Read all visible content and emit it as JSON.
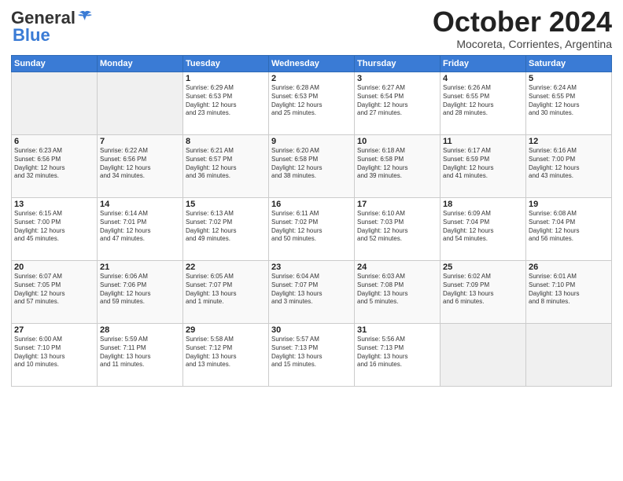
{
  "header": {
    "logo_general": "General",
    "logo_blue": "Blue",
    "month": "October 2024",
    "location": "Mocoreta, Corrientes, Argentina"
  },
  "weekdays": [
    "Sunday",
    "Monday",
    "Tuesday",
    "Wednesday",
    "Thursday",
    "Friday",
    "Saturday"
  ],
  "weeks": [
    [
      {
        "day": "",
        "info": ""
      },
      {
        "day": "",
        "info": ""
      },
      {
        "day": "1",
        "info": "Sunrise: 6:29 AM\nSunset: 6:53 PM\nDaylight: 12 hours\nand 23 minutes."
      },
      {
        "day": "2",
        "info": "Sunrise: 6:28 AM\nSunset: 6:53 PM\nDaylight: 12 hours\nand 25 minutes."
      },
      {
        "day": "3",
        "info": "Sunrise: 6:27 AM\nSunset: 6:54 PM\nDaylight: 12 hours\nand 27 minutes."
      },
      {
        "day": "4",
        "info": "Sunrise: 6:26 AM\nSunset: 6:55 PM\nDaylight: 12 hours\nand 28 minutes."
      },
      {
        "day": "5",
        "info": "Sunrise: 6:24 AM\nSunset: 6:55 PM\nDaylight: 12 hours\nand 30 minutes."
      }
    ],
    [
      {
        "day": "6",
        "info": "Sunrise: 6:23 AM\nSunset: 6:56 PM\nDaylight: 12 hours\nand 32 minutes."
      },
      {
        "day": "7",
        "info": "Sunrise: 6:22 AM\nSunset: 6:56 PM\nDaylight: 12 hours\nand 34 minutes."
      },
      {
        "day": "8",
        "info": "Sunrise: 6:21 AM\nSunset: 6:57 PM\nDaylight: 12 hours\nand 36 minutes."
      },
      {
        "day": "9",
        "info": "Sunrise: 6:20 AM\nSunset: 6:58 PM\nDaylight: 12 hours\nand 38 minutes."
      },
      {
        "day": "10",
        "info": "Sunrise: 6:18 AM\nSunset: 6:58 PM\nDaylight: 12 hours\nand 39 minutes."
      },
      {
        "day": "11",
        "info": "Sunrise: 6:17 AM\nSunset: 6:59 PM\nDaylight: 12 hours\nand 41 minutes."
      },
      {
        "day": "12",
        "info": "Sunrise: 6:16 AM\nSunset: 7:00 PM\nDaylight: 12 hours\nand 43 minutes."
      }
    ],
    [
      {
        "day": "13",
        "info": "Sunrise: 6:15 AM\nSunset: 7:00 PM\nDaylight: 12 hours\nand 45 minutes."
      },
      {
        "day": "14",
        "info": "Sunrise: 6:14 AM\nSunset: 7:01 PM\nDaylight: 12 hours\nand 47 minutes."
      },
      {
        "day": "15",
        "info": "Sunrise: 6:13 AM\nSunset: 7:02 PM\nDaylight: 12 hours\nand 49 minutes."
      },
      {
        "day": "16",
        "info": "Sunrise: 6:11 AM\nSunset: 7:02 PM\nDaylight: 12 hours\nand 50 minutes."
      },
      {
        "day": "17",
        "info": "Sunrise: 6:10 AM\nSunset: 7:03 PM\nDaylight: 12 hours\nand 52 minutes."
      },
      {
        "day": "18",
        "info": "Sunrise: 6:09 AM\nSunset: 7:04 PM\nDaylight: 12 hours\nand 54 minutes."
      },
      {
        "day": "19",
        "info": "Sunrise: 6:08 AM\nSunset: 7:04 PM\nDaylight: 12 hours\nand 56 minutes."
      }
    ],
    [
      {
        "day": "20",
        "info": "Sunrise: 6:07 AM\nSunset: 7:05 PM\nDaylight: 12 hours\nand 57 minutes."
      },
      {
        "day": "21",
        "info": "Sunrise: 6:06 AM\nSunset: 7:06 PM\nDaylight: 12 hours\nand 59 minutes."
      },
      {
        "day": "22",
        "info": "Sunrise: 6:05 AM\nSunset: 7:07 PM\nDaylight: 13 hours\nand 1 minute."
      },
      {
        "day": "23",
        "info": "Sunrise: 6:04 AM\nSunset: 7:07 PM\nDaylight: 13 hours\nand 3 minutes."
      },
      {
        "day": "24",
        "info": "Sunrise: 6:03 AM\nSunset: 7:08 PM\nDaylight: 13 hours\nand 5 minutes."
      },
      {
        "day": "25",
        "info": "Sunrise: 6:02 AM\nSunset: 7:09 PM\nDaylight: 13 hours\nand 6 minutes."
      },
      {
        "day": "26",
        "info": "Sunrise: 6:01 AM\nSunset: 7:10 PM\nDaylight: 13 hours\nand 8 minutes."
      }
    ],
    [
      {
        "day": "27",
        "info": "Sunrise: 6:00 AM\nSunset: 7:10 PM\nDaylight: 13 hours\nand 10 minutes."
      },
      {
        "day": "28",
        "info": "Sunrise: 5:59 AM\nSunset: 7:11 PM\nDaylight: 13 hours\nand 11 minutes."
      },
      {
        "day": "29",
        "info": "Sunrise: 5:58 AM\nSunset: 7:12 PM\nDaylight: 13 hours\nand 13 minutes."
      },
      {
        "day": "30",
        "info": "Sunrise: 5:57 AM\nSunset: 7:13 PM\nDaylight: 13 hours\nand 15 minutes."
      },
      {
        "day": "31",
        "info": "Sunrise: 5:56 AM\nSunset: 7:13 PM\nDaylight: 13 hours\nand 16 minutes."
      },
      {
        "day": "",
        "info": ""
      },
      {
        "day": "",
        "info": ""
      }
    ]
  ]
}
